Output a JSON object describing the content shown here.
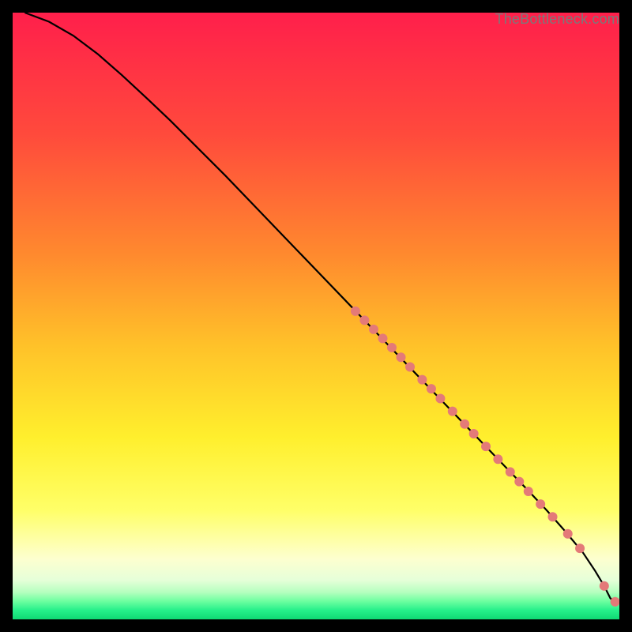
{
  "attribution": "TheBottleneck.com",
  "chart_data": {
    "type": "line",
    "title": "",
    "xlabel": "",
    "ylabel": "",
    "xlim": [
      0,
      100
    ],
    "ylim": [
      0,
      100
    ],
    "grid": false,
    "legend": false,
    "background_gradient_stops": [
      {
        "pos": 0.0,
        "color": "#ff1f4b"
      },
      {
        "pos": 0.2,
        "color": "#ff4a3c"
      },
      {
        "pos": 0.4,
        "color": "#ff8a2e"
      },
      {
        "pos": 0.55,
        "color": "#ffc229"
      },
      {
        "pos": 0.7,
        "color": "#ffef2d"
      },
      {
        "pos": 0.82,
        "color": "#ffff68"
      },
      {
        "pos": 0.9,
        "color": "#fdffcf"
      },
      {
        "pos": 0.935,
        "color": "#e6ffd9"
      },
      {
        "pos": 0.955,
        "color": "#b6ffbf"
      },
      {
        "pos": 0.97,
        "color": "#6effa0"
      },
      {
        "pos": 0.985,
        "color": "#26f08a"
      },
      {
        "pos": 1.0,
        "color": "#0fd873"
      }
    ],
    "series": [
      {
        "name": "curve",
        "stroke": "#000000",
        "x": [
          2,
          6,
          10,
          14,
          18,
          22,
          26,
          30,
          35,
          40,
          45,
          50,
          55,
          60,
          65,
          70,
          75,
          80,
          85,
          88,
          91,
          94,
          96,
          97.5,
          98.5,
          99.3
        ],
        "y": [
          100,
          98.5,
          96.2,
          93.2,
          89.7,
          86.0,
          82.2,
          78.2,
          73.2,
          68.0,
          62.8,
          57.6,
          52.4,
          47.2,
          42.0,
          36.8,
          31.6,
          26.4,
          21.2,
          18.0,
          14.6,
          11.0,
          8.0,
          5.5,
          3.5,
          2.7
        ]
      }
    ],
    "overlay_points": {
      "name": "dots",
      "color": "#e47a78",
      "radius_px": 6,
      "x": [
        56.5,
        58.0,
        59.5,
        61.0,
        62.5,
        64.0,
        65.5,
        67.5,
        69.0,
        70.5,
        72.5,
        74.5,
        76.0,
        78.0,
        80.0,
        82.0,
        83.5,
        85.0,
        87.0,
        89.0,
        91.5,
        93.5,
        97.5,
        99.3
      ],
      "y": [
        50.8,
        49.3,
        47.8,
        46.3,
        44.8,
        43.2,
        41.6,
        39.5,
        38.0,
        36.4,
        34.3,
        32.2,
        30.6,
        28.5,
        26.4,
        24.3,
        22.7,
        21.1,
        19.0,
        16.9,
        14.1,
        11.7,
        5.5,
        2.9
      ]
    }
  }
}
